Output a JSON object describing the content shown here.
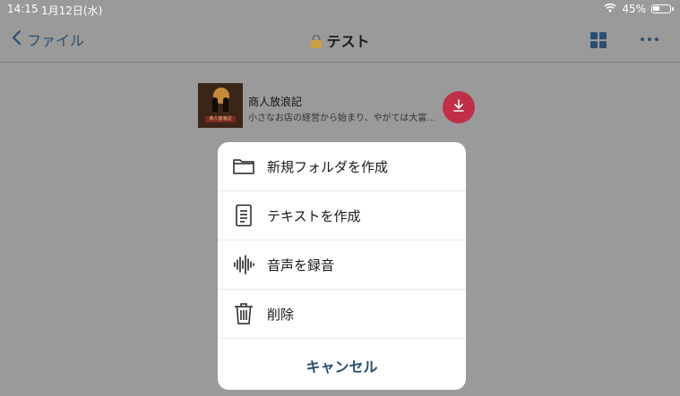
{
  "status": {
    "time": "14:15",
    "date": "1月12日(水)",
    "wifi_icon": "wifi-icon",
    "battery_text": "45%",
    "battery_level": 0.45
  },
  "nav": {
    "back_label": "ファイル",
    "title": "テスト",
    "grid_icon": "grid-view-icon",
    "more_icon": "more-icon"
  },
  "file": {
    "title": "商人放浪記",
    "subtitle": "小さなお店の経営から始まり、やがては大富...",
    "thumb_text": "商人放浪記",
    "download_icon": "download-icon",
    "download_color": "#bf2f48"
  },
  "sheet": {
    "items": [
      {
        "label": "新規フォルダを作成",
        "icon": "folder-icon"
      },
      {
        "label": "テキストを作成",
        "icon": "document-icon"
      },
      {
        "label": "音声を録音",
        "icon": "waveform-icon"
      },
      {
        "label": "削除",
        "icon": "trash-icon"
      }
    ],
    "cancel_label": "キャンセル"
  },
  "colors": {
    "accent": "#2d4e6e",
    "background": "#9a9a9a"
  }
}
